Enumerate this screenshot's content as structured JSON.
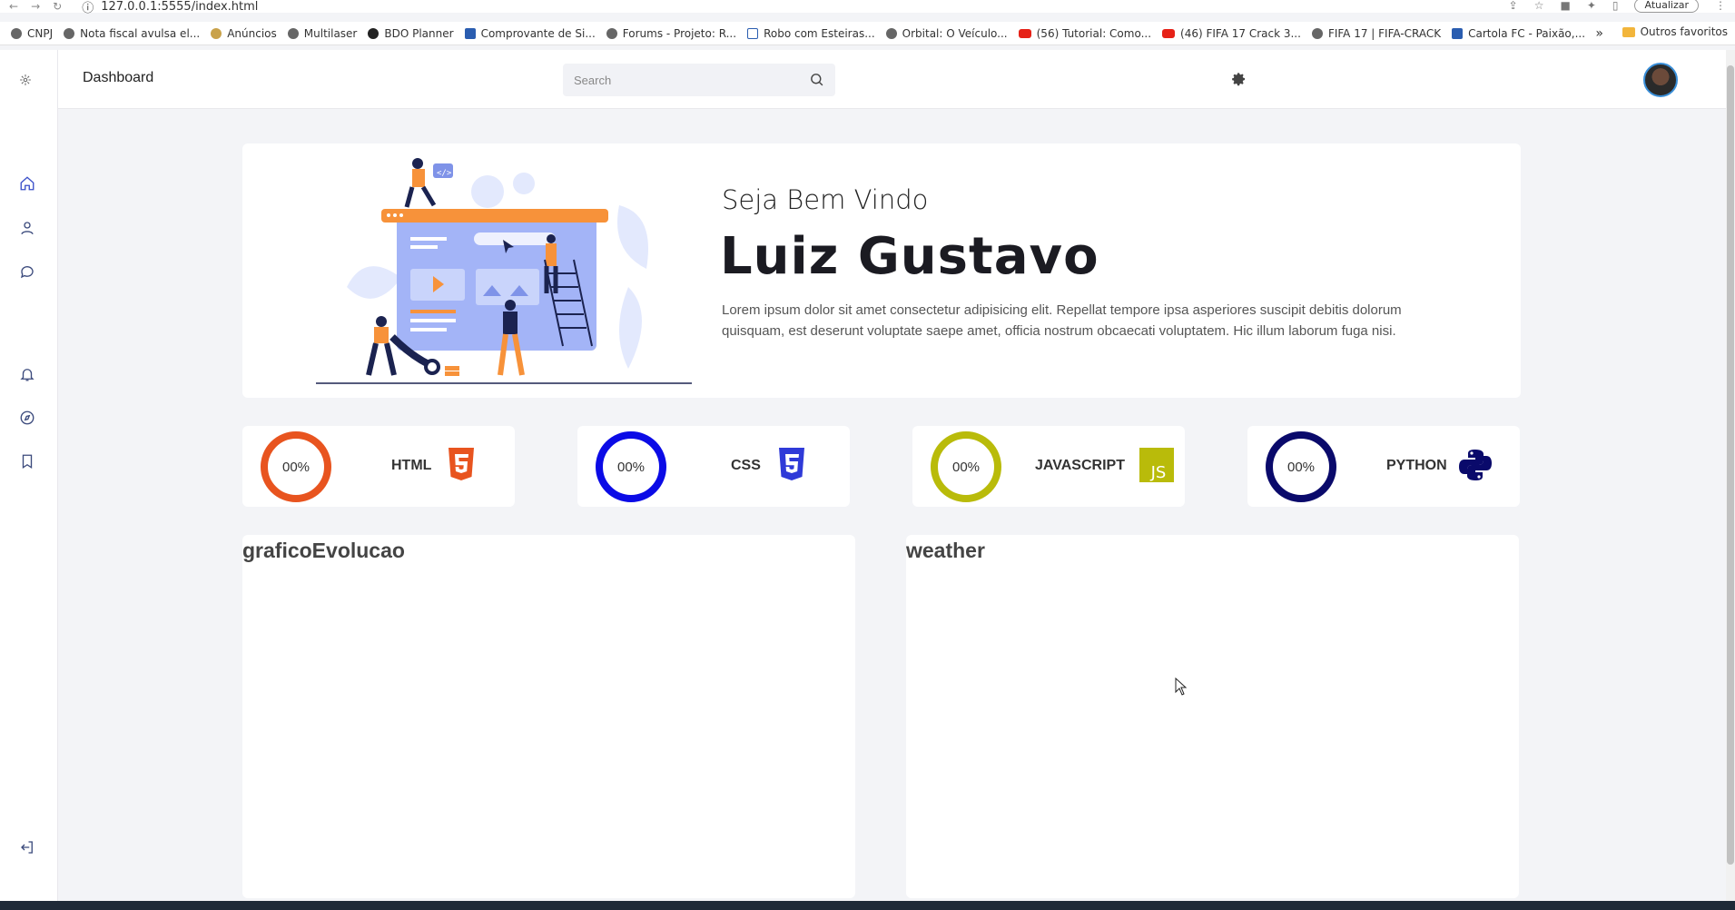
{
  "browser": {
    "url": "127.0.0.1:5555/index.html",
    "update_label": "Atualizar",
    "bookmarks": [
      {
        "label": "CNPJ",
        "icon": "globe-icon"
      },
      {
        "label": "Nota fiscal avulsa el...",
        "icon": "globe-icon"
      },
      {
        "label": "Anúncios",
        "icon": "globe-icon"
      },
      {
        "label": "Multilaser",
        "icon": "globe-icon"
      },
      {
        "label": "BDO Planner",
        "icon": "globe-icon"
      },
      {
        "label": "Comprovante de Si...",
        "icon": "globe-icon"
      },
      {
        "label": "Forums - Projeto: R...",
        "icon": "globe-icon"
      },
      {
        "label": "Robo com Esteiras...",
        "icon": "globe-icon"
      },
      {
        "label": "Orbital: O Veículo...",
        "icon": "globe-icon"
      },
      {
        "label": "(56) Tutorial: Como...",
        "icon": "youtube-icon"
      },
      {
        "label": "(46) FIFA 17 Crack 3...",
        "icon": "youtube-icon"
      },
      {
        "label": "FIFA 17 | FIFA-CRACK",
        "icon": "globe-icon"
      },
      {
        "label": "Cartola FC - Paixão,...",
        "icon": "globe-icon"
      }
    ],
    "other_bookmarks": "Outros favoritos"
  },
  "topbar": {
    "title": "Dashboard",
    "search_placeholder": "Search"
  },
  "hero": {
    "welcome": "Seja Bem Vindo",
    "name": "Luiz Gustavo",
    "description": "Lorem ipsum dolor sit amet consectetur adipisicing elit. Repellat tempore ipsa asperiores suscipit debitis dolorum quisquam, est deserunt voluptate saepe amet, officia nostrum obcaecati voluptatem. Hic illum laborum fuga nisi."
  },
  "skills": [
    {
      "label": "HTML",
      "percent": "00%",
      "color": "#e8541f",
      "icon": "html5-icon"
    },
    {
      "label": "CSS",
      "percent": "00%",
      "color": "#0b0be6",
      "icon": "css3-icon"
    },
    {
      "label": "JAVASCRIPT",
      "percent": "00%",
      "color": "#b9bb0a",
      "icon": "javascript-icon"
    },
    {
      "label": "PYTHON",
      "percent": "00%",
      "color": "#0a0a6b",
      "icon": "python-icon"
    }
  ],
  "panels": [
    {
      "title": "graficoEvolucao"
    },
    {
      "title": "weather"
    }
  ],
  "colors": {
    "accent": "#3a4fc9",
    "illustration_orange": "#f7923a",
    "illustration_blue": "#a3b4f7"
  }
}
